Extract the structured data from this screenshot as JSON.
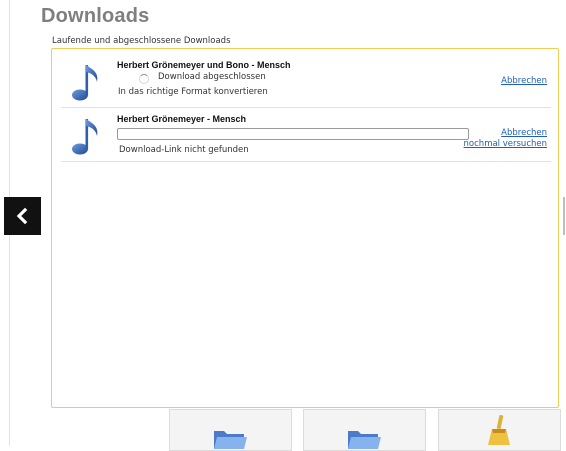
{
  "header": {
    "title": "Downloads",
    "subtitle": "Laufende und abgeschlossene Downloads"
  },
  "downloads": [
    {
      "title": "Herbert Grönemeyer und Bono - Mensch",
      "status": "Download abgeschlossen",
      "detail": "In das richtige Format konvertieren",
      "actions": [
        "Abbrechen"
      ]
    },
    {
      "title": "Herbert Grönemeyer - Mensch",
      "progress": 0,
      "detail": "Download-Link nicht gefunden",
      "actions": [
        "Abbrechen",
        "nochmal versuchen"
      ]
    }
  ],
  "icons": {
    "item": "music-note-icon",
    "back": "chevron-left-icon",
    "bottom_buttons": [
      "folder-icon",
      "folder-icon",
      "broom-icon"
    ]
  },
  "colors": {
    "accent_border": "#f2cd55",
    "link": "#1f5fb5",
    "note_blue": "#2e5fa8",
    "title_gray": "#7f7f7f"
  }
}
